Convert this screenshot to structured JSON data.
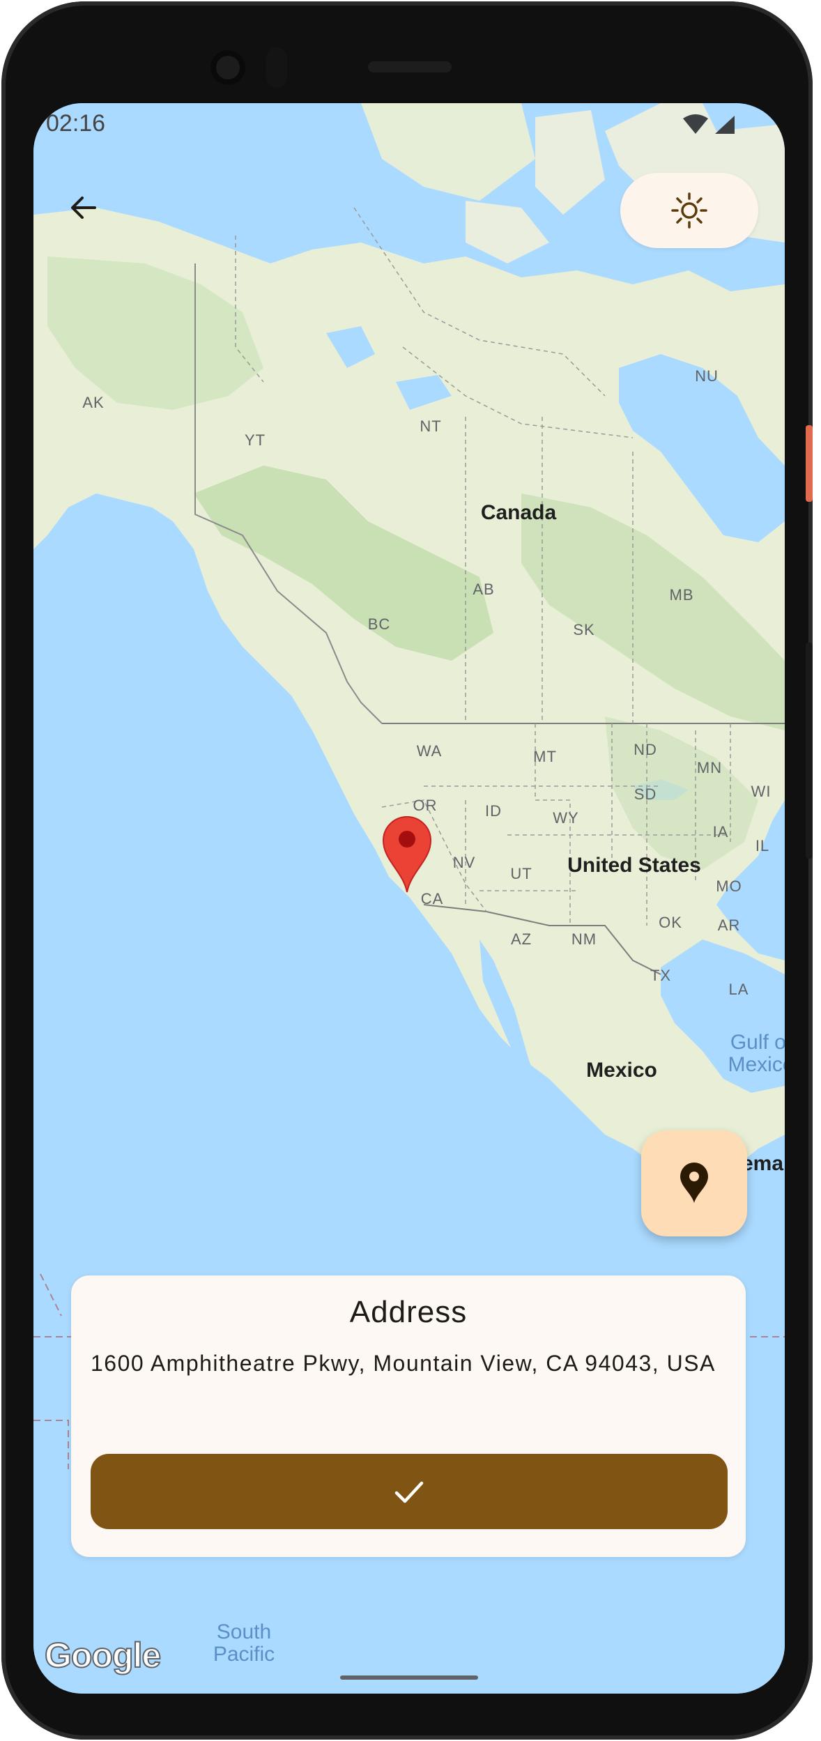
{
  "status_bar": {
    "time": "02:16"
  },
  "toolbar": {
    "back_icon": "arrow-left-icon",
    "theme_icon": "sun-icon"
  },
  "map": {
    "countries": [
      "Canada",
      "United States",
      "Mexico"
    ],
    "states": [
      "AK",
      "YT",
      "NT",
      "NU",
      "BC",
      "AB",
      "SK",
      "MB",
      "WA",
      "MT",
      "ND",
      "MN",
      "OR",
      "ID",
      "WY",
      "SD",
      "WI",
      "NV",
      "UT",
      "IA",
      "IL",
      "CA",
      "MO",
      "OK",
      "AR",
      "AZ",
      "NM",
      "TX",
      "LA"
    ],
    "water": [
      "Gulf of Mexico",
      "South Pacific"
    ],
    "partial": "ema",
    "attribution": "Google"
  },
  "fab": {
    "icon": "location-pin-icon"
  },
  "address_card": {
    "title": "Address",
    "address": "1600 Amphitheatre Pkwy, Mountain View, CA 94043, USA",
    "confirm_icon": "check-icon"
  },
  "colors": {
    "water": "#aadaff",
    "land": "#e8efd6",
    "primary": "#805413",
    "fab_bg": "#fddcb6",
    "marker": "#ea4335"
  }
}
